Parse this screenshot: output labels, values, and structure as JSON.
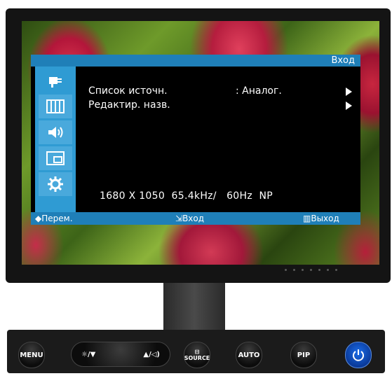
{
  "osd": {
    "title": "Вход",
    "menu": [
      {
        "label": "Список источн.",
        "value": ": Аналог."
      },
      {
        "label": "Редактир. назв.",
        "value": ""
      }
    ],
    "resolution": "1680 X 1050  65.4kHz/   60Hz  NP",
    "footer": {
      "move": "Перем.",
      "enter": "Вход",
      "exit": "Выход"
    },
    "sidebar_icons": [
      "input-icon",
      "picture-icon",
      "sound-icon",
      "pip-icon",
      "setup-icon"
    ]
  },
  "buttons": {
    "menu": "MENU",
    "brightness_down": "/▼",
    "up_volume": "▲/",
    "source": "SOURCE",
    "auto": "AUTO",
    "pip": "PIP"
  },
  "colors": {
    "osd_blue": "#1f7fb8",
    "osd_sidebar": "#2f9bd3",
    "power_blue": "#1a6ce8"
  }
}
